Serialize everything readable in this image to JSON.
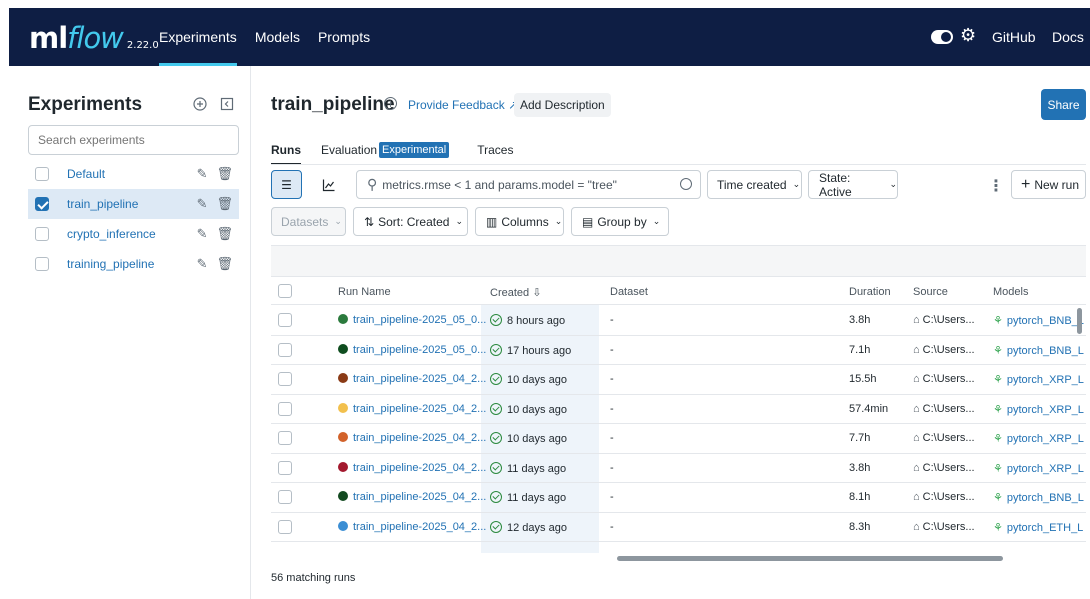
{
  "header": {
    "logo_main": "ml",
    "logo_flow": "flow",
    "version": "2.22.0",
    "nav": [
      {
        "label": "Experiments",
        "active": true
      },
      {
        "label": "Models",
        "active": false
      },
      {
        "label": "Prompts",
        "active": false
      }
    ],
    "github": "GitHub",
    "docs": "Docs",
    "accent_color": "#43c9ed",
    "bg_color": "#0e1e44"
  },
  "sidebar": {
    "title": "Experiments",
    "add_icon": "plus-circle-icon",
    "collapse_icon": "collapse-panel-icon",
    "search_placeholder": "Search experiments",
    "items": [
      {
        "label": "Default",
        "checked": false
      },
      {
        "label": "train_pipeline",
        "checked": true
      },
      {
        "label": "crypto_inference",
        "checked": false
      },
      {
        "label": "training_pipeline",
        "checked": false
      }
    ]
  },
  "main": {
    "title": "train_pipeline",
    "feedback": "Provide Feedback",
    "add_description": "Add Description",
    "share": "Share",
    "tabs": [
      {
        "label": "Runs",
        "active": true
      },
      {
        "label": "Evaluation",
        "badge": "Experimental"
      },
      {
        "label": "Traces"
      }
    ],
    "query": "metrics.rmse < 1 and params.model = \"tree\"",
    "time_created": "Time created",
    "state": "State: Active",
    "new_run": "New run",
    "datasets": "Datasets",
    "sort": "Sort: Created",
    "columns": "Columns",
    "group_by": "Group by",
    "columns_header": {
      "run_name": "Run Name",
      "created": "Created",
      "dataset": "Dataset",
      "duration": "Duration",
      "source": "Source",
      "models": "Models"
    },
    "rows": [
      {
        "name": "train_pipeline-2025_05_0...",
        "color": "#2b7a3d",
        "created": "8 hours ago",
        "dataset": "-",
        "duration": "3.8h",
        "source": "C:\\Users...",
        "model": "pytorch_BNB_L"
      },
      {
        "name": "train_pipeline-2025_05_0...",
        "color": "#0f4d1f",
        "created": "17 hours ago",
        "dataset": "-",
        "duration": "7.1h",
        "source": "C:\\Users...",
        "model": "pytorch_BNB_L"
      },
      {
        "name": "train_pipeline-2025_04_2...",
        "color": "#8a3a16",
        "created": "10 days ago",
        "dataset": "-",
        "duration": "15.5h",
        "source": "C:\\Users...",
        "model": "pytorch_XRP_L"
      },
      {
        "name": "train_pipeline-2025_04_2...",
        "color": "#f2c04d",
        "created": "10 days ago",
        "dataset": "-",
        "duration": "57.4min",
        "source": "C:\\Users...",
        "model": "pytorch_XRP_L"
      },
      {
        "name": "train_pipeline-2025_04_2...",
        "color": "#d2622a",
        "created": "10 days ago",
        "dataset": "-",
        "duration": "7.7h",
        "source": "C:\\Users...",
        "model": "pytorch_XRP_L"
      },
      {
        "name": "train_pipeline-2025_04_2...",
        "color": "#a3192e",
        "created": "11 days ago",
        "dataset": "-",
        "duration": "3.8h",
        "source": "C:\\Users...",
        "model": "pytorch_XRP_L"
      },
      {
        "name": "train_pipeline-2025_04_2...",
        "color": "#134a20",
        "created": "11 days ago",
        "dataset": "-",
        "duration": "8.1h",
        "source": "C:\\Users...",
        "model": "pytorch_BNB_L"
      },
      {
        "name": "train_pipeline-2025_04_2...",
        "color": "#3b8ed4",
        "created": "12 days ago",
        "dataset": "-",
        "duration": "8.3h",
        "source": "C:\\Users...",
        "model": "pytorch_ETH_L"
      }
    ],
    "footer": "56 matching runs"
  }
}
